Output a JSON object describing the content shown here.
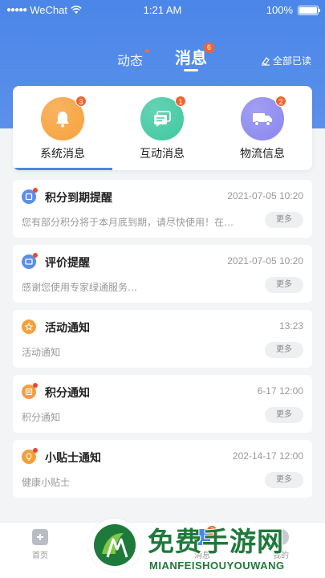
{
  "status_bar": {
    "carrier": "WeChat",
    "time": "1:21 AM",
    "battery": "100%",
    "battery_level": 1.0
  },
  "top_tabs": {
    "dongtai": "动态",
    "xiaoxi": "消息",
    "xiaoxi_badge": "6",
    "read_all": "全部已读"
  },
  "categories": [
    {
      "label": "系统消息",
      "badge": "3",
      "color": "#f7a13a",
      "icon": "bell-icon",
      "active": true
    },
    {
      "label": "互动消息",
      "badge": "1",
      "color": "#3fc8a0",
      "icon": "chat-icon",
      "active": false
    },
    {
      "label": "物流信息",
      "badge": "2",
      "color": "#8a86ef",
      "icon": "truck-icon",
      "active": false
    }
  ],
  "messages": [
    {
      "title": "积分到期提醒",
      "time": "2021-07-05 10:20",
      "body": "您有部分积分将于本月底到期，请尽快使用！在…",
      "more": "更多",
      "icon": "points-expiry-icon",
      "color": "#5b8fe8",
      "unread": true
    },
    {
      "title": "评价提醒",
      "time": "2021-07-05 10:20",
      "body": "感谢您使用专家绿通服务…",
      "more": "更多",
      "icon": "review-icon",
      "color": "#5b8fe8",
      "unread": true
    },
    {
      "title": "活动通知",
      "time": "13:23",
      "body": "活动通知",
      "more": "更多",
      "icon": "activity-icon",
      "color": "#f3a03a",
      "unread": false
    },
    {
      "title": "积分通知",
      "time": "6-17 12:00",
      "body": "积分通知",
      "more": "更多",
      "icon": "points-icon",
      "color": "#f3a03a",
      "unread": true
    },
    {
      "title": "小贴士通知",
      "time": "202-14-17 12:00",
      "body": "健康小贴士",
      "more": "更多",
      "icon": "tips-icon",
      "color": "#f3a03a",
      "unread": true
    }
  ],
  "tabbar": {
    "home": "首页",
    "message": "消息",
    "message_badge": "3",
    "mine": "我的"
  },
  "watermark": {
    "title": "免费手游网",
    "subtitle": "MIANFEISHOUYOUWANG"
  },
  "colors": {
    "primary": "#4b86e8",
    "badge": "#f0652e",
    "watermark": "#1e7a3b"
  }
}
